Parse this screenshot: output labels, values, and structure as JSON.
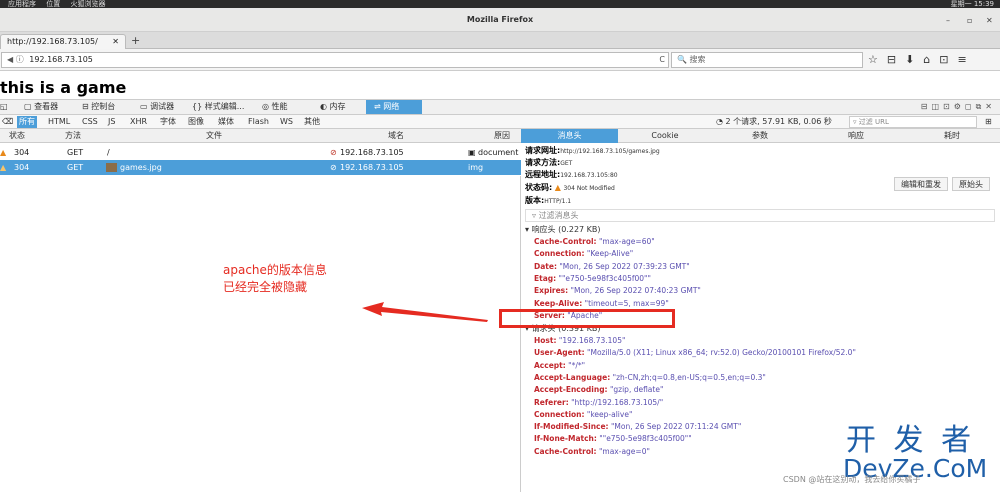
{
  "gnome_bar": {
    "applications": "应用程序",
    "places": "位置",
    "app": "火狐浏览器",
    "clock": "星期一 15:39"
  },
  "window": {
    "title": "Mozilla Firefox",
    "min": "–",
    "max": "▫",
    "close": "✕"
  },
  "browser_tab": {
    "label": "http://192.168.73.105/",
    "close": "✕",
    "new_tab": "+"
  },
  "navbar": {
    "url": "192.168.73.105",
    "search_placeholder": "搜索",
    "reload": "C"
  },
  "page": {
    "heading": "this is a game"
  },
  "devtools": {
    "tabs": [
      "查看器",
      "控制台",
      "调试器",
      "样式编辑...",
      "性能",
      "内存",
      "网络"
    ],
    "active_tab": "网络",
    "filters": [
      "所有",
      "HTML",
      "CSS",
      "JS",
      "XHR",
      "字体",
      "图像",
      "媒体",
      "Flash",
      "WS",
      "其他"
    ],
    "summary": "2 个请求, 57.91 KB, 0.06 秒",
    "filter_url_placeholder": "过滤 URL",
    "columns": {
      "status": "状态",
      "method": "方法",
      "file": "文件",
      "domain": "域名",
      "cause": "原因"
    },
    "requests": [
      {
        "status": "304",
        "method": "GET",
        "file": "/",
        "domain": "192.168.73.105",
        "cause": "document"
      },
      {
        "status": "304",
        "method": "GET",
        "file": "games.jpg",
        "domain": "192.168.73.105",
        "cause": "img"
      }
    ],
    "detail_tabs": [
      "消息头",
      "Cookie",
      "参数",
      "响应",
      "耗时"
    ],
    "summary_lines": {
      "url_label": "请求网址:",
      "url": "http://192.168.73.105/games.jpg",
      "method_label": "请求方法:",
      "method": "GET",
      "remote_label": "远程地址:",
      "remote": "192.168.73.105:80",
      "status_label": "状态码:",
      "status": "304 Not Modified",
      "version_label": "版本:",
      "version": "HTTP/1.1"
    },
    "buttons": {
      "edit_resend": "编辑和重发",
      "raw_headers": "原始头"
    },
    "header_filter_placeholder": "过滤消息头",
    "response_headers_title": "响应头 (0.227 KB)",
    "response_headers": [
      {
        "k": "Cache-Control:",
        "v": "\"max-age=60\""
      },
      {
        "k": "Connection:",
        "v": "\"Keep-Alive\""
      },
      {
        "k": "Date:",
        "v": "\"Mon, 26 Sep 2022 07:39:23 GMT\""
      },
      {
        "k": "Etag:",
        "v": "\"\"e750-5e98f3c405f00\"\""
      },
      {
        "k": "Expires:",
        "v": "\"Mon, 26 Sep 2022 07:40:23 GMT\""
      },
      {
        "k": "Keep-Alive:",
        "v": "\"timeout=5, max=99\""
      },
      {
        "k": "Server:",
        "v": "\"Apache\""
      }
    ],
    "request_headers_title": "请求头 (0.391 KB)",
    "request_headers": [
      {
        "k": "Host:",
        "v": "\"192.168.73.105\""
      },
      {
        "k": "User-Agent:",
        "v": "\"Mozilla/5.0 (X11; Linux x86_64; rv:52.0) Gecko/20100101 Firefox/52.0\""
      },
      {
        "k": "Accept:",
        "v": "\"*/*\""
      },
      {
        "k": "Accept-Language:",
        "v": "\"zh-CN,zh;q=0.8,en-US;q=0.5,en;q=0.3\""
      },
      {
        "k": "Accept-Encoding:",
        "v": "\"gzip, deflate\""
      },
      {
        "k": "Referer:",
        "v": "\"http://192.168.73.105/\""
      },
      {
        "k": "Connection:",
        "v": "\"keep-alive\""
      },
      {
        "k": "If-Modified-Since:",
        "v": "\"Mon, 26 Sep 2022 07:11:24 GMT\""
      },
      {
        "k": "If-None-Match:",
        "v": "\"\"e750-5e98f3c405f00\"\""
      },
      {
        "k": "Cache-Control:",
        "v": "\"max-age=0\""
      }
    ]
  },
  "annotation": {
    "line1": "apache的版本信息",
    "line2": "已经完全被隐藏"
  },
  "watermark": {
    "cn": "开 发 者",
    "en": "DevZe.CoM",
    "csdn": "CSDN @站在这别动，我去给你买橘子"
  },
  "colors": {
    "accent": "#4c9ed9",
    "annotation": "#e52b21",
    "header_key": "#c1272d",
    "header_value": "#5a4fb0"
  }
}
